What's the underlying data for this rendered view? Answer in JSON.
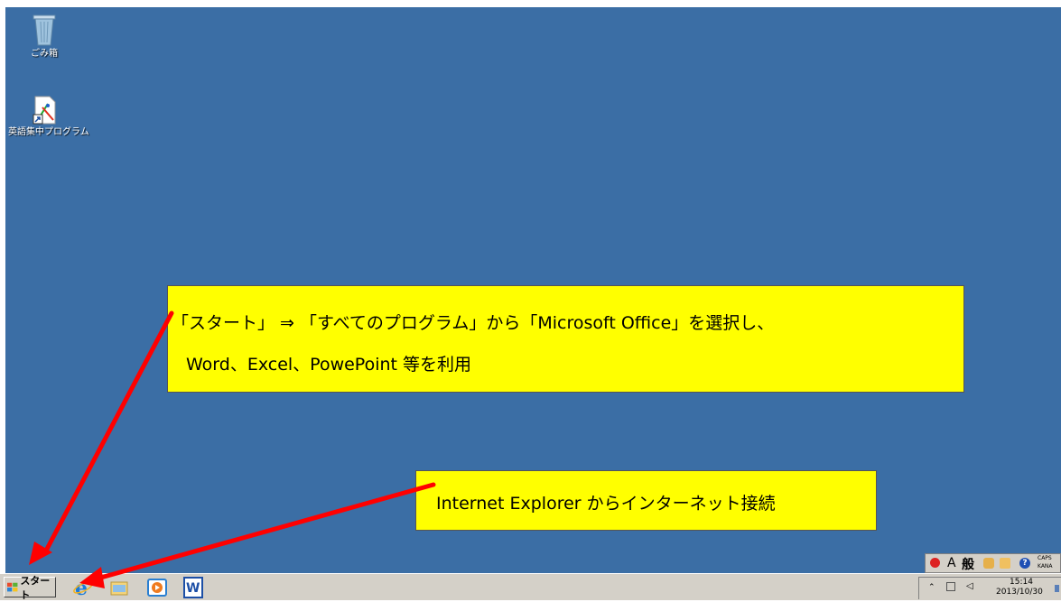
{
  "desktop": {
    "icons": [
      {
        "label": "ごみ箱",
        "icon": "recycle-bin-icon"
      },
      {
        "label": "英語集中プログラム",
        "icon": "shortcut-icon"
      }
    ]
  },
  "callouts": {
    "office": {
      "line1": "「スタート」 ⇒ 「すべてのプログラム」から「Microsoft Office」を選択し、",
      "line2": "Word、Excel、PowePoint 等を利用"
    },
    "internet": {
      "line1": "Internet Explorer からインターネット接続"
    }
  },
  "taskbar": {
    "start_label": "スタート",
    "quick_launch": [
      "ie-icon",
      "explorer-folder-icon",
      "media-player-icon",
      "word-icon"
    ]
  },
  "language_bar": {
    "mode": "A",
    "mode2": "般",
    "caps": "CAPS",
    "kana": "KANA"
  },
  "tray": {
    "time": "15:14",
    "date": "2013/10/30"
  },
  "colors": {
    "desktop": "#3b6ea5",
    "callout": "#ffff00",
    "arrow": "#ff0000",
    "taskbar": "#d4d0c8"
  }
}
